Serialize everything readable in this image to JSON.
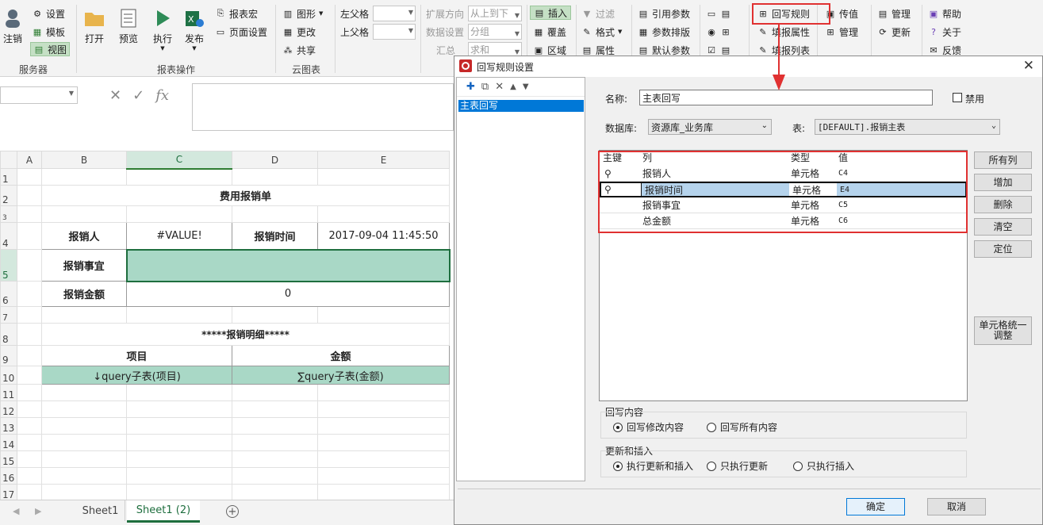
{
  "ribbon": {
    "server": {
      "logout": "注销",
      "settings": "设置",
      "template": "模板",
      "view": "视图",
      "group": "服务器"
    },
    "report": {
      "open": "打开",
      "preview": "预览",
      "execute": "执行",
      "publish": "发布",
      "macro": "报表宏",
      "page_setup": "页面设置",
      "group": "报表操作"
    },
    "cloud": {
      "chart": "图形",
      "change": "更改",
      "share": "共享",
      "group": "云图表"
    },
    "parent": {
      "left": "左父格",
      "top": "上父格"
    },
    "expand": {
      "direction_label": "扩展方向",
      "direction_value": "从上到下",
      "data_label": "数据设置",
      "data_value": "分组",
      "agg_label": "汇总",
      "agg_value": "求和"
    },
    "insert": {
      "insert": "插入",
      "cover": "覆盖",
      "area": "区域"
    },
    "format": {
      "filter": "过滤",
      "format": "格式",
      "property": "属性"
    },
    "params": {
      "ref": "引用参数",
      "layout": "参数排版",
      "default": "默认参数"
    },
    "fill": {
      "writeback": "回写规则",
      "fill_prop": "填报属性",
      "fill_list": "填报列表"
    },
    "transfer": {
      "pass": "传值",
      "manage": "管理"
    },
    "admin": {
      "manage": "管理",
      "update": "更新"
    },
    "help": {
      "help": "帮助",
      "about": "关于",
      "feedback": "反馈"
    }
  },
  "formula": {
    "fx": "fx"
  },
  "sheet": {
    "cols": [
      "A",
      "B",
      "C",
      "D",
      "E"
    ],
    "rows": [
      "1",
      "2",
      "3",
      "4",
      "5",
      "6",
      "7",
      "8",
      "9",
      "10",
      "11",
      "12",
      "13",
      "14",
      "15",
      "16",
      "17"
    ],
    "title": "费用报销单",
    "reporter_label": "报销人",
    "reporter_value": "#VALUE!",
    "time_label": "报销时间",
    "time_value": "2017-09-04 11:45:50",
    "matter_label": "报销事宜",
    "amount_label": "报销金额",
    "amount_value": "0",
    "detail_title": "*****报销明细*****",
    "item_header": "项目",
    "amount_header": "金额",
    "item_value": "↓query子表(项目)",
    "amount_sum": "∑query子表(金额)"
  },
  "tabs": {
    "sheet1": "Sheet1",
    "sheet2": "Sheet1 (2)"
  },
  "dialog": {
    "title": "回写规则设置",
    "tree": [
      "主表回写"
    ],
    "name_label": "名称:",
    "name_value": "主表回写",
    "disable_label": "禁用",
    "db_label": "数据库:",
    "db_value": "资源库_业务库",
    "table_label": "表:",
    "table_value": "[DEFAULT].报销主表",
    "grid_headers": [
      "主键",
      "列",
      "类型",
      "值"
    ],
    "grid_rows": [
      {
        "key": true,
        "col": "报销人",
        "type": "单元格",
        "val": "C4"
      },
      {
        "key": true,
        "col": "报销时间",
        "type": "单元格",
        "val": "E4"
      },
      {
        "key": false,
        "col": "报销事宜",
        "type": "单元格",
        "val": "C5"
      },
      {
        "key": false,
        "col": "总金额",
        "type": "单元格",
        "val": "C6"
      }
    ],
    "side_buttons": [
      "所有列",
      "增加",
      "删除",
      "清空",
      "定位"
    ],
    "unify_button": "单元格统一调整",
    "wb_group": "回写内容",
    "wb_opt1": "回写修改内容",
    "wb_opt2": "回写所有内容",
    "ui_group": "更新和插入",
    "ui_opt1": "执行更新和插入",
    "ui_opt2": "只执行更新",
    "ui_opt3": "只执行插入",
    "ok": "确定",
    "cancel": "取消"
  }
}
